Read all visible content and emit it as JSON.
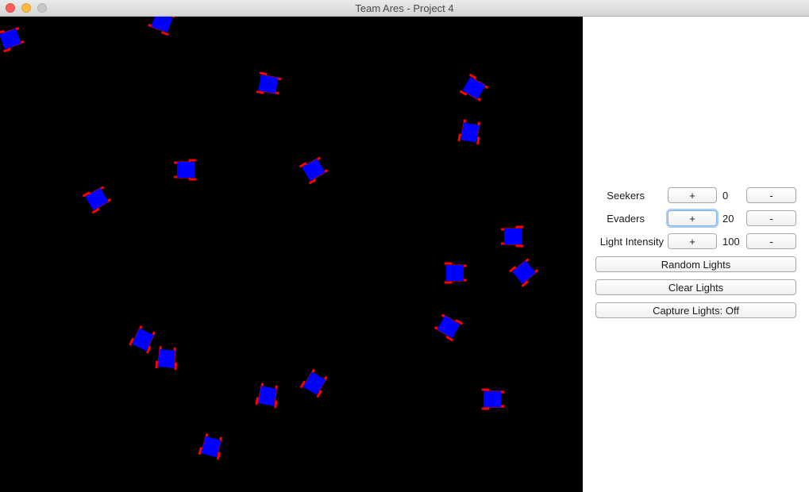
{
  "window": {
    "title": "Team Ares - Project 4"
  },
  "controls": {
    "seekers": {
      "label": "Seekers",
      "value": "0",
      "plus": "+",
      "minus": "-"
    },
    "evaders": {
      "label": "Evaders",
      "value": "20",
      "plus": "+",
      "minus": "-"
    },
    "light_intensity": {
      "label": "Light Intensity",
      "value": "100",
      "plus": "+",
      "minus": "-"
    }
  },
  "buttons": {
    "random_lights": "Random Lights",
    "clear_lights": "Clear Lights",
    "capture_lights": "Capture Lights: Off"
  },
  "colors": {
    "arena_background": "#000000",
    "robot_body": "#0000ff",
    "robot_wheels": "#ff0000"
  }
}
